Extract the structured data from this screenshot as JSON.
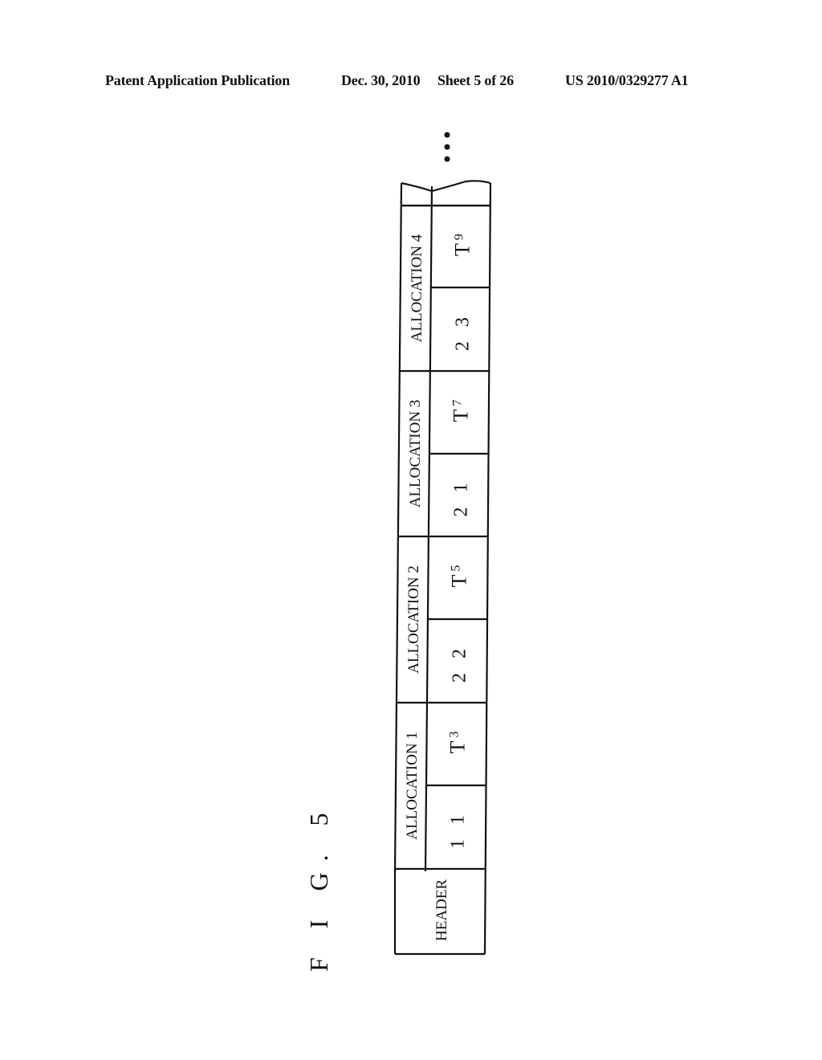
{
  "header": {
    "publication": "Patent Application Publication",
    "date": "Dec. 30, 2010",
    "sheet": "Sheet 5 of 26",
    "number": "US 2010/0329277 A1"
  },
  "figure": {
    "label": "F I G. 5",
    "continuation_marker": "...",
    "header_cell": "HEADER",
    "allocations": [
      {
        "label": "ALLOCATION 1",
        "id": "1 1",
        "t_main": "T",
        "t_sub": "3"
      },
      {
        "label": "ALLOCATION 2",
        "id": "2 2",
        "t_main": "T",
        "t_sub": "5"
      },
      {
        "label": "ALLOCATION 3",
        "id": "2 1",
        "t_main": "T",
        "t_sub": "7"
      },
      {
        "label": "ALLOCATION 4",
        "id": "2 3",
        "t_main": "T",
        "t_sub": "9"
      }
    ]
  }
}
